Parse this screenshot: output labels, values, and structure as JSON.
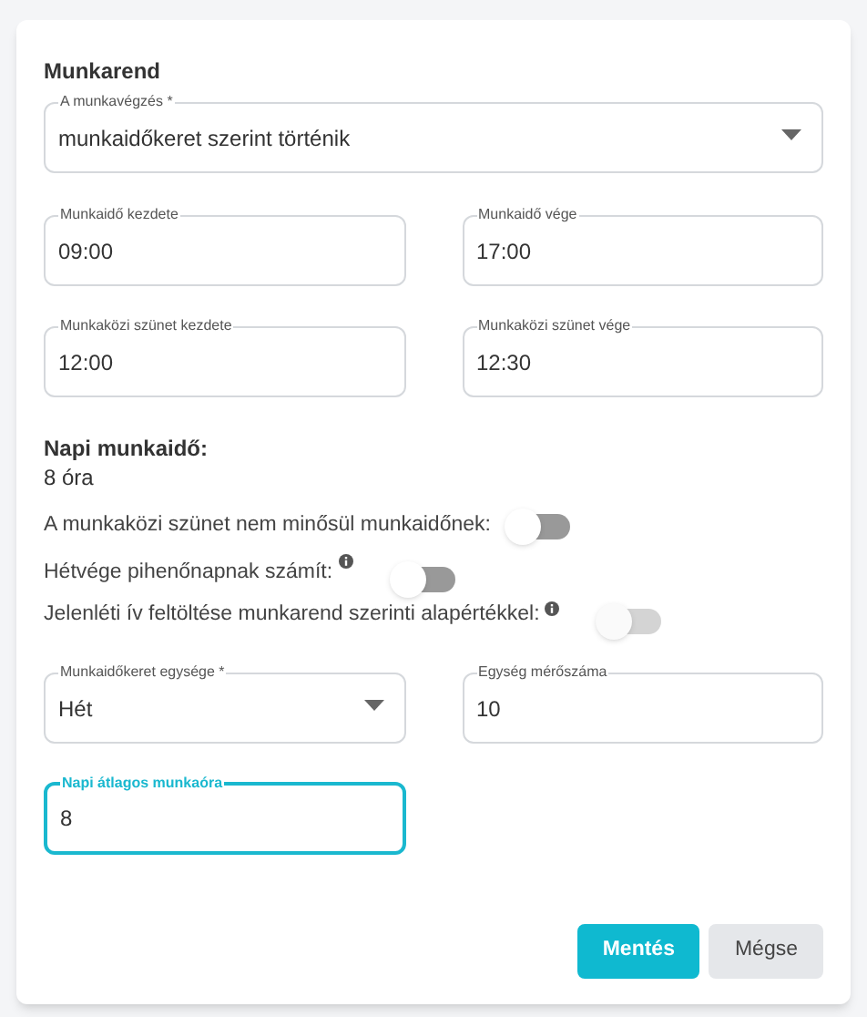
{
  "section_title": "Munkarend",
  "main_field": {
    "kind": "select",
    "label": "A munkavégzés *",
    "value": "munkaidőkeret szerint történik",
    "focused": false
  },
  "time_fields": [
    {
      "kind": "text",
      "label": "Munkaidő kezdete",
      "value": "09:00",
      "focused": false
    },
    {
      "kind": "text",
      "label": "Munkaidő vége",
      "value": "17:00",
      "focused": false
    },
    {
      "kind": "text",
      "label": "Munkaközi szünet kezdete",
      "value": "12:00",
      "focused": false
    },
    {
      "kind": "text",
      "label": "Munkaközi szünet vége",
      "value": "12:30",
      "focused": false
    }
  ],
  "summary": {
    "label": "Napi munkaidő:",
    "value": "8 óra"
  },
  "switches": [
    {
      "kind": "plain",
      "label": "A munkaközi szünet nem minősül munkaidőnek:",
      "on": false,
      "disabled": false
    },
    {
      "kind": "with_info",
      "label": "Hétvége pihenőnapnak számít:",
      "on": false,
      "disabled": false
    },
    {
      "kind": "with_info",
      "label": "Jelenléti ív feltöltése munkarend szerinti alapértékkel:",
      "on": false,
      "disabled": true
    }
  ],
  "frame_fields": [
    {
      "kind": "select",
      "label": "Munkaidőkeret egysége *",
      "value": "Hét",
      "focused": false
    },
    {
      "kind": "text",
      "label": "Egység mérőszáma",
      "value": "10",
      "focused": false
    },
    {
      "kind": "text",
      "label": "Napi átlagos munkaóra",
      "value": "8",
      "focused": true
    }
  ],
  "buttons": [
    {
      "kind": "primary",
      "label": "Mentés"
    },
    {
      "kind": "secondary",
      "label": "Mégse"
    }
  ]
}
